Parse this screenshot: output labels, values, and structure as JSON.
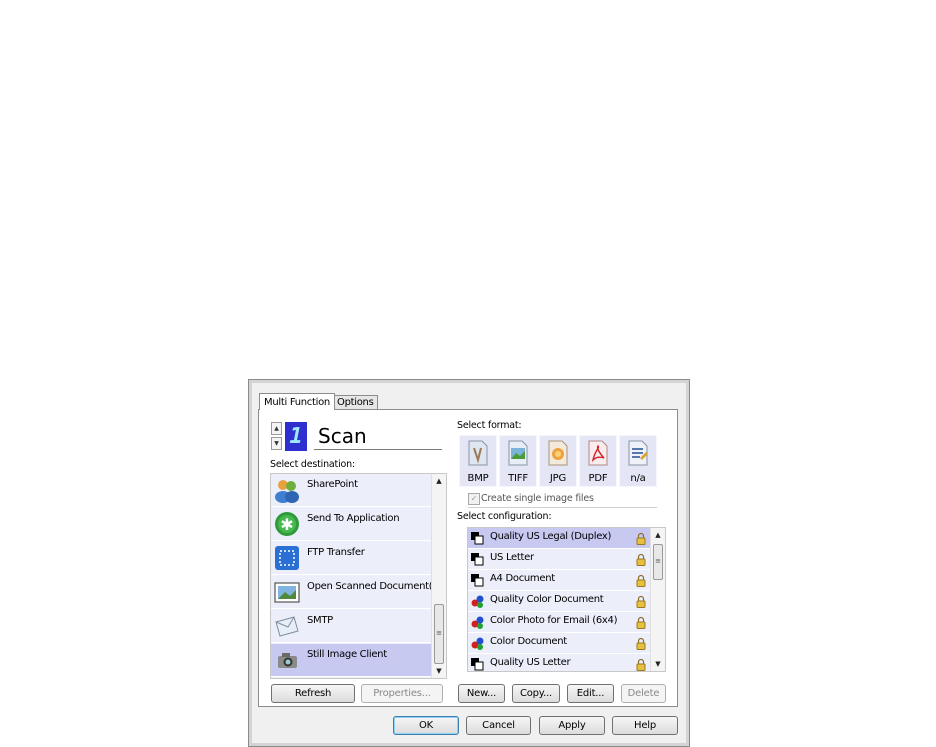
{
  "tabs": [
    {
      "label": "Multi Function",
      "active": true
    },
    {
      "label": "Options",
      "active": false
    }
  ],
  "profile": {
    "counter": "1",
    "name": "Scan"
  },
  "destination": {
    "label": "Select destination:",
    "items": [
      {
        "label": "SharePoint",
        "icon": "sharepoint-icon",
        "selected": false
      },
      {
        "label": "Send To Application",
        "icon": "send-to-application-icon",
        "selected": false
      },
      {
        "label": "FTP Transfer",
        "icon": "ftp-transfer-icon",
        "selected": false
      },
      {
        "label": "Open Scanned Document(s)",
        "icon": "open-document-icon",
        "selected": false
      },
      {
        "label": "SMTP",
        "icon": "smtp-envelope-icon",
        "selected": false
      },
      {
        "label": "Still Image Client",
        "icon": "still-image-client-icon",
        "selected": true
      }
    ],
    "refresh": "Refresh",
    "properties": "Properties..."
  },
  "format": {
    "label": "Select format:",
    "items": [
      {
        "label": "BMP",
        "icon": "bmp-file-icon"
      },
      {
        "label": "TIFF",
        "icon": "tiff-file-icon"
      },
      {
        "label": "JPG",
        "icon": "jpg-file-icon"
      },
      {
        "label": "PDF",
        "icon": "pdf-file-icon"
      },
      {
        "label": "n/a",
        "icon": "text-document-icon"
      }
    ],
    "single_image": "Create single image files",
    "single_image_checked": true
  },
  "configuration": {
    "label": "Select configuration:",
    "items": [
      {
        "label": "Quality US Legal (Duplex)",
        "icon": "bw-document-icon",
        "selected": true
      },
      {
        "label": "US Letter",
        "icon": "bw-document-icon",
        "selected": false
      },
      {
        "label": "A4 Document",
        "icon": "bw-document-icon",
        "selected": false
      },
      {
        "label": "Quality Color Document",
        "icon": "color-document-icon",
        "selected": false
      },
      {
        "label": "Color Photo for Email (6x4)",
        "icon": "color-document-icon",
        "selected": false
      },
      {
        "label": "Color Document",
        "icon": "color-document-icon",
        "selected": false
      },
      {
        "label": "Quality US Letter",
        "icon": "bw-document-icon",
        "selected": false
      }
    ],
    "new": "New...",
    "copy": "Copy...",
    "edit": "Edit...",
    "delete": "Delete"
  },
  "footer": {
    "ok": "OK",
    "cancel": "Cancel",
    "apply": "Apply",
    "help": "Help"
  },
  "colors": {
    "selection": "#c7c9f1",
    "list_bg": "#eceefa",
    "counter_bg": "#2f2fd0"
  }
}
